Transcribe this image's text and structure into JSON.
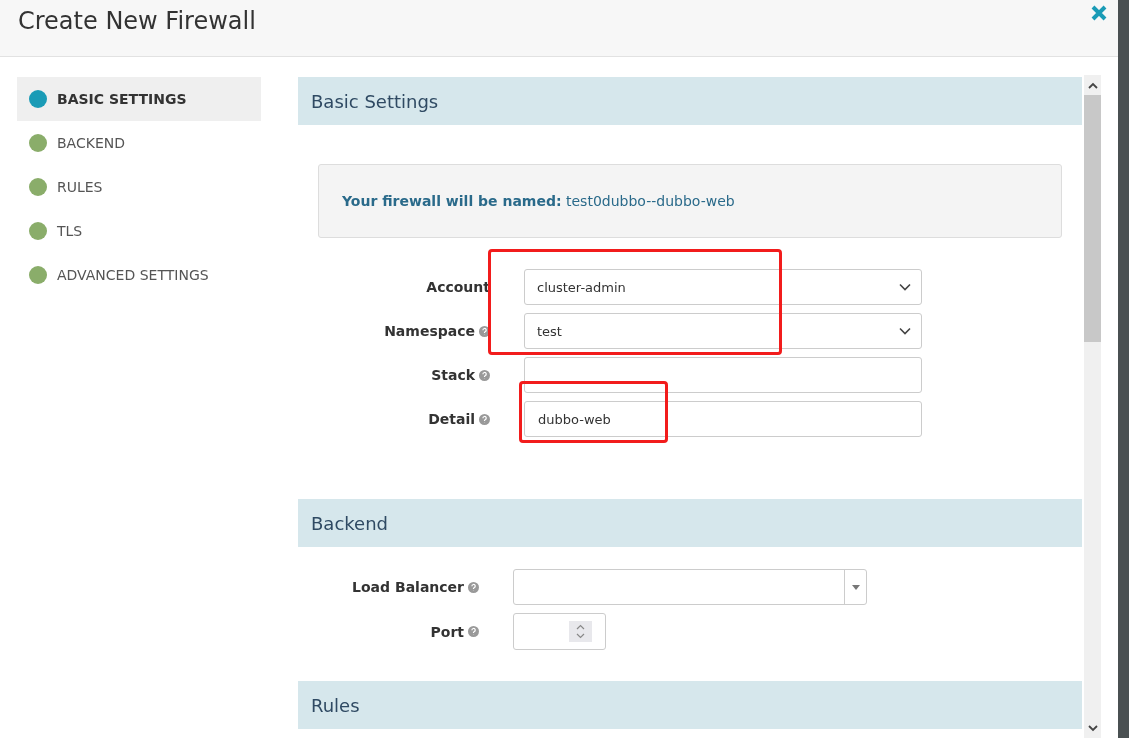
{
  "window": {
    "title": "Create New Firewall"
  },
  "sidebar": {
    "items": [
      {
        "label": "BASIC SETTINGS",
        "selected": true
      },
      {
        "label": "BACKEND",
        "selected": false
      },
      {
        "label": "RULES",
        "selected": false
      },
      {
        "label": "TLS",
        "selected": false
      },
      {
        "label": "ADVANCED SETTINGS",
        "selected": false
      }
    ]
  },
  "sections": [
    {
      "kind": "basic",
      "title": "Basic Settings",
      "notice": {
        "label": "Your firewall will be named:",
        "value": "test0dubbo--dubbo-web"
      },
      "fields": [
        {
          "label": "Account",
          "help": false,
          "kind": "select",
          "value": "cluster-admin",
          "framed": true
        },
        {
          "label": "Namespace",
          "help": true,
          "kind": "select",
          "value": "test",
          "framed": true
        },
        {
          "label": "Stack",
          "help": true,
          "kind": "text",
          "framed": false
        },
        {
          "label": "Detail",
          "help": true,
          "kind": "text",
          "value": "dubbo-web",
          "framed": true
        }
      ]
    },
    {
      "kind": "backend",
      "title": "Backend",
      "fields": [
        {
          "label": "Load Balancer",
          "help": true,
          "kind": "combo",
          "framed": false
        },
        {
          "label": "Port",
          "help": true,
          "kind": "number",
          "framed": false
        }
      ]
    },
    {
      "kind": "rules",
      "title": "Rules"
    }
  ]
}
